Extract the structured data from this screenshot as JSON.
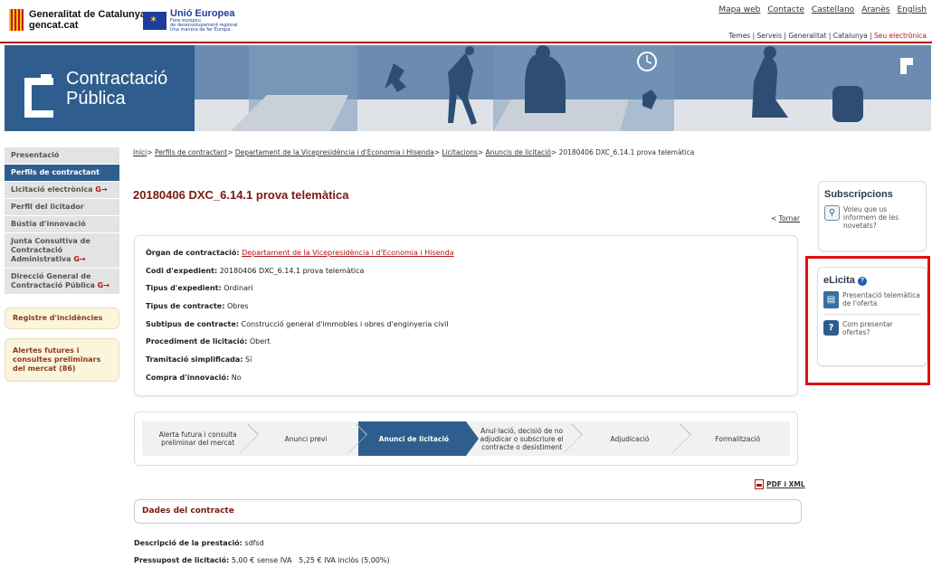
{
  "header": {
    "gencat_line1": "Generalitat de Catalunya",
    "gencat_line2": "gencat.cat",
    "eu_title": "Unió Europea",
    "eu_sub1": "Fons europeu",
    "eu_sub2": "de desenvolupament regional",
    "eu_sub3": "Una manera de fer Europa",
    "links": [
      "Mapa web",
      "Contacte",
      "Castellano",
      "Aranès",
      "English"
    ],
    "sublinks": [
      "Temes",
      "Serveis",
      "Generalitat",
      "Catalunya"
    ],
    "seu": "Seu electrònica"
  },
  "banner": {
    "line1": "Contractació",
    "line2": "Pública"
  },
  "leftmenu": {
    "items": [
      {
        "label": "Presentació"
      },
      {
        "label": "Perfils de contractant"
      },
      {
        "label": "Licitació electrònica",
        "ext": "G→"
      },
      {
        "label": "Perfil del licitador"
      },
      {
        "label": "Bústia d'innovació"
      },
      {
        "label": "Junta Consultiva de Contractació Administrativa",
        "ext": "G→"
      },
      {
        "label": "Direcció General de Contractació Pública",
        "ext": "G→"
      }
    ],
    "box1": "Registre d'incidències",
    "box2": "Alertes futures i consultes preliminars del mercat (86)"
  },
  "breadcrumb": {
    "items": [
      "Inici",
      "Perfils de contractant",
      "Departament de la Vicepresidència i d'Economia i Hisenda",
      "Licitacions",
      "Anuncis de licitació"
    ],
    "current": "20180406 DXC_6.14.1 prova telemàtica"
  },
  "title": "20180406 DXC_6.14.1 prova telemàtica",
  "tornar": "Tornar",
  "details": [
    {
      "label": "Òrgan de contractació:",
      "value": "Departament de la Vicepresidència i d'Economia i Hisenda"
    },
    {
      "label": "Codi d'expedient:",
      "value": "20180406 DXC_6.14.1 prova telemàtica"
    },
    {
      "label": "Tipus d'expedient:",
      "value": "Ordinari"
    },
    {
      "label": "Tipus de contracte:",
      "value": "Obres"
    },
    {
      "label": "Subtipus de contracte:",
      "value": "Construcció general d'immobles i obres d'enginyeria civil"
    },
    {
      "label": "Procediment de licitació:",
      "value": "Obert"
    },
    {
      "label": "Tramitació simplificada:",
      "value": "Sí"
    },
    {
      "label": "Compra d'innovació:",
      "value": "No"
    }
  ],
  "steps": [
    "Alerta futura i consulta preliminar del mercat",
    "Anunci previ",
    "Anunci de licitació",
    "Anul·lació, decisió de no adjudicar o subscriure el contracte o desistiment",
    "Adjudicació",
    "Formalització"
  ],
  "pdf": "PDF i XML",
  "section": "Dades del contracte",
  "info": {
    "desc_label": "Descripció de la prestació:",
    "desc_value": "sdfsd",
    "press_label": "Pressupost de licitació:",
    "press_value": "5,00 € sense IVA   5,25 € IVA inclòs (5,00%)"
  },
  "sidebar": {
    "subs_title": "Subscripcions",
    "subs_text": "Voleu que us informem de les novetats?",
    "elicita_title": "eLicita",
    "elicita_item1": "Presentació telemàtica de l'oferta",
    "elicita_item2": "Com presentar ofertes?"
  }
}
